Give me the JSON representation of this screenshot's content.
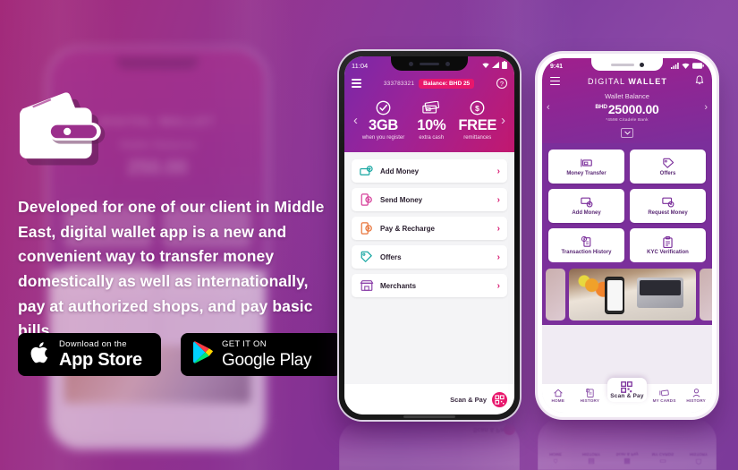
{
  "brand": {
    "accent_pink": "#e8176c",
    "accent_purple": "#7b2f9b",
    "bg_gradient_from": "#a32a7a",
    "bg_gradient_to": "#7b3a9a"
  },
  "hero": {
    "wallet_icon": "wallet-icon",
    "body_text": "Developed for one of our client in Middle East, digital wallet app is a new and convenient way to transfer money domestically as well as internationally, pay at authorized shops, and pay basic bills."
  },
  "store_badges": [
    {
      "icon": "apple-logo-icon",
      "small": "Download on the",
      "big": "App Store"
    },
    {
      "icon": "google-play-icon",
      "small": "GET IT ON",
      "big": "Google Play"
    }
  ],
  "background_phone": {
    "title": "DIGITAL WALLET",
    "balance_label": "Wallet Balance",
    "amount": "250.00"
  },
  "center_phone": {
    "status": {
      "time": "11:04",
      "wifi_icon": "wifi-icon",
      "signal_icon": "signal-icon",
      "battery_icon": "battery-icon"
    },
    "menu_icon": "hamburger-menu-icon",
    "account_number": "333783321",
    "balance_chip": "Balance: BHD 25",
    "help_icon": "help-icon",
    "help_label": "?",
    "carousel": {
      "prev_icon": "chevron-left-icon",
      "next_icon": "chevron-right-icon",
      "prev_label": "‹",
      "next_label": "›",
      "promos": [
        {
          "icon": "check-circle-icon",
          "headline": "3GB",
          "caption": "when you register"
        },
        {
          "icon": "cash-notes-icon",
          "headline": "10%",
          "caption": "extra cash"
        },
        {
          "icon": "dollar-circle-icon",
          "headline": "FREE",
          "caption": "remittances"
        }
      ]
    },
    "menu_items": [
      {
        "icon": "add-money-icon",
        "label": "Add Money",
        "chevron": "›",
        "color": "#13a5a0"
      },
      {
        "icon": "send-money-icon",
        "label": "Send Money",
        "chevron": "›",
        "color": "#d6409a"
      },
      {
        "icon": "pay-recharge-icon",
        "label": "Pay & Recharge",
        "chevron": "›",
        "color": "#e8743a"
      },
      {
        "icon": "offers-tag-icon",
        "label": "Offers",
        "chevron": "›",
        "color": "#13a5a0"
      },
      {
        "icon": "merchants-shop-icon",
        "label": "Merchants",
        "chevron": "›",
        "color": "#8a3fa8"
      }
    ],
    "scan_pay": {
      "label": "Scan & Pay",
      "icon": "qr-code-icon"
    }
  },
  "right_phone": {
    "status": {
      "time": "9:41",
      "signal_icon": "signal-icon",
      "wifi_icon": "wifi-icon",
      "battery_icon": "battery-icon"
    },
    "menu_icon": "hamburger-menu-icon",
    "title_light": "DIGITAL ",
    "title_bold": "WALLET",
    "bell_icon": "bell-icon",
    "balance_label": "Wallet Balance",
    "currency": "BHD",
    "balance_amount": "25000.00",
    "bank_line": "*4598  Citadele Bank",
    "prev_icon": "chevron-left-icon",
    "next_icon": "chevron-right-icon",
    "prev_label": "‹",
    "next_label": "›",
    "expand_icon": "chevron-down-icon",
    "expand_label": "⌄",
    "services": [
      {
        "icon": "money-transfer-icon",
        "label": "Money Transfer"
      },
      {
        "icon": "offers-tag-icon",
        "label": "Offers"
      },
      {
        "icon": "add-money-icon",
        "label": "Add Money"
      },
      {
        "icon": "request-money-icon",
        "label": "Request Money"
      },
      {
        "icon": "transaction-history-icon",
        "label": "Transaction History"
      },
      {
        "icon": "kyc-clipboard-icon",
        "label": "KYC Verification"
      }
    ],
    "promo_photo_alt": "hand-holding-phone-at-desk-photo",
    "bottom_nav": [
      {
        "icon": "home-icon",
        "label": "HOME",
        "active": false
      },
      {
        "icon": "history-icon",
        "label": "HISTORY",
        "active": false
      },
      {
        "icon": "qr-code-icon",
        "label": "Scan & Pay",
        "active": true
      },
      {
        "icon": "cards-icon",
        "label": "MY CARDS",
        "active": false
      },
      {
        "icon": "profile-icon",
        "label": "HISTORY",
        "active": false
      }
    ]
  }
}
